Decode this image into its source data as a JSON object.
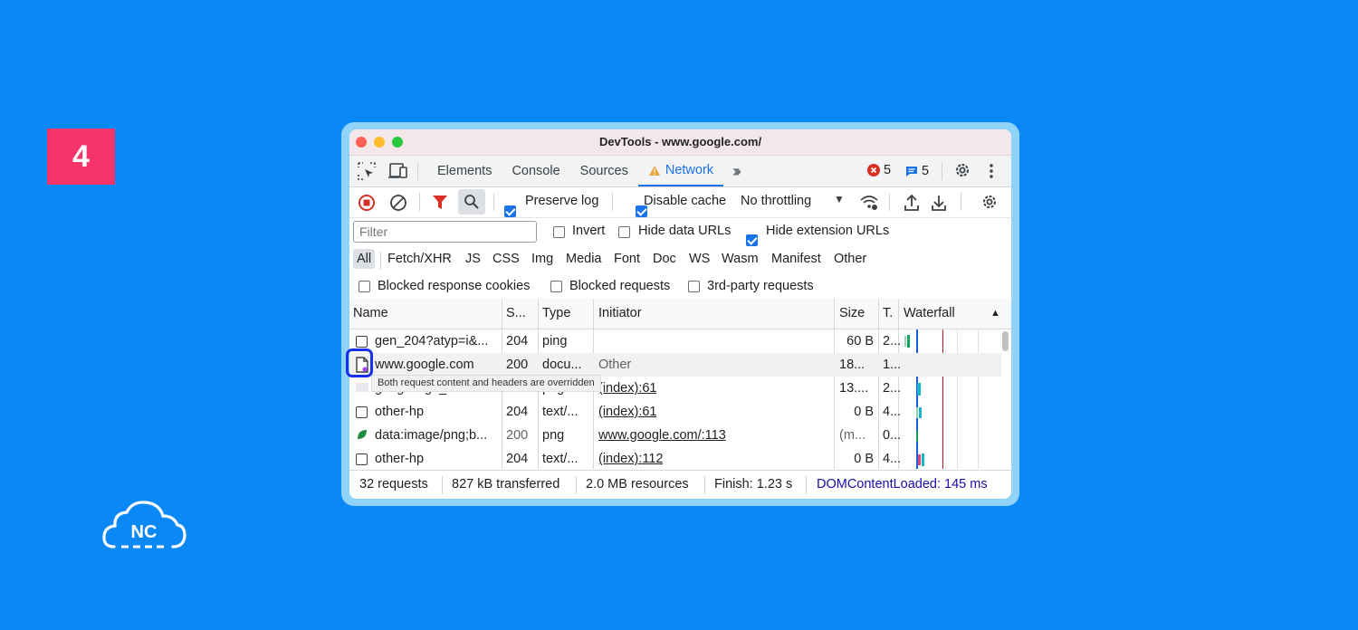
{
  "step": "4",
  "logo_text": "NC",
  "window": {
    "title": "DevTools - www.google.com/"
  },
  "tabs": [
    "Elements",
    "Console",
    "Sources",
    "Network"
  ],
  "active_tab": "Network",
  "badges": {
    "errors": "5",
    "messages": "5"
  },
  "toolbar": {
    "preserve_log": "Preserve log",
    "disable_cache": "Disable cache",
    "throttling": "No throttling"
  },
  "filter": {
    "placeholder": "Filter",
    "invert": "Invert",
    "hide_data_urls": "Hide data URLs",
    "hide_extension_urls": "Hide extension URLs"
  },
  "types": [
    "All",
    "Fetch/XHR",
    "JS",
    "CSS",
    "Img",
    "Media",
    "Font",
    "Doc",
    "WS",
    "Wasm",
    "Manifest",
    "Other"
  ],
  "blocked": {
    "response_cookies": "Blocked response cookies",
    "requests": "Blocked requests",
    "third_party": "3rd-party requests"
  },
  "columns": {
    "name": "Name",
    "status": "S...",
    "type": "Type",
    "initiator": "Initiator",
    "size": "Size",
    "time": "T.",
    "waterfall": "Waterfall"
  },
  "rows": [
    {
      "name": "gen_204?atyp=i&...",
      "status": "204",
      "type": "ping",
      "initiator": "",
      "size": "60 B",
      "time": "2..."
    },
    {
      "name": "www.google.com",
      "status": "200",
      "type": "docu...",
      "initiator": "Other",
      "size": "18...",
      "time": "1..."
    },
    {
      "name": "googlelogo_co...",
      "status": "200",
      "type": "png",
      "initiator": "(index):61",
      "size": "13....",
      "time": "2..."
    },
    {
      "name": "other-hp",
      "status": "204",
      "type": "text/...",
      "initiator": "(index):61",
      "size": "0 B",
      "time": "4..."
    },
    {
      "name": "data:image/png;b...",
      "status": "200",
      "type": "png",
      "initiator": "www.google.com/:113",
      "size": "(m...",
      "time": "0..."
    },
    {
      "name": "other-hp",
      "status": "204",
      "type": "text/...",
      "initiator": "(index):112",
      "size": "0 B",
      "time": "4..."
    }
  ],
  "tooltip": "Both request content and headers are overridden",
  "status": {
    "requests": "32 requests",
    "transferred": "827 kB transferred",
    "resources": "2.0 MB resources",
    "finish": "Finish: 1.23 s",
    "dcl": "DOMContentLoaded: 145 ms"
  }
}
